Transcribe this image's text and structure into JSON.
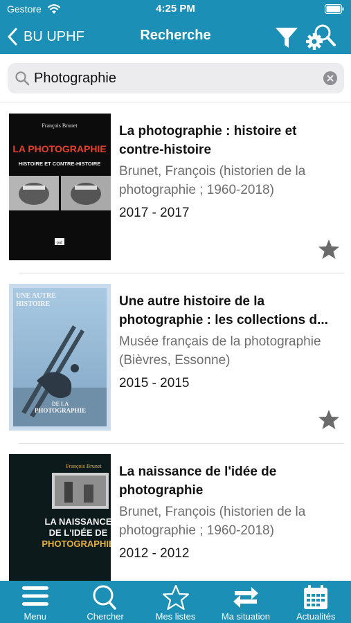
{
  "status": {
    "carrier": "Gestore",
    "time": "4:25 PM"
  },
  "nav": {
    "back_label": "BU UPHF",
    "title": "Recherche"
  },
  "search": {
    "value": "Photographie"
  },
  "results": [
    {
      "title_line1": "La photographie : histoire et",
      "title_line2": "contre-histoire",
      "author_line1": "Brunet, François (historien de la",
      "author_line2": "photographie ; 1960-2018)",
      "date": "2017 - 2017",
      "cover": {
        "author": "François Brunet",
        "title_line1": "LA PHOTOGRAPHIE",
        "title_line2": "HISTOIRE ET CONTRE-HISTOIRE",
        "publisher": "puf"
      }
    },
    {
      "title_line1": "Une autre histoire de la",
      "title_line2": "photographie : les collections d...",
      "author_line1": "Musée français de la photographie",
      "author_line2": "(Bièvres, Essonne)",
      "date": "2015 - 2015",
      "cover": {
        "top_line1": "UNE AUTRE",
        "top_line2": "HISTOIRE",
        "bottom_line1": "DE LA",
        "bottom_line2": "PHOTOGRAPHIE"
      }
    },
    {
      "title_line1": "La naissance de l'idée de",
      "title_line2": "photographie",
      "author_line1": "Brunet, François (historien de la",
      "author_line2": "photographie ; 1960-2018)",
      "date": "2012 - 2012",
      "cover": {
        "author": "François Brunet",
        "line1": "LA NAISSANCE",
        "line2": "DE L'IDÉE DE",
        "line3": "PHOTOGRAPHIE"
      }
    }
  ],
  "tabs": [
    {
      "label": "Menu",
      "icon": "menu-icon"
    },
    {
      "label": "Chercher",
      "icon": "search-icon"
    },
    {
      "label": "Mes listes",
      "icon": "star-outline-icon"
    },
    {
      "label": "Ma situation",
      "icon": "swap-arrows-icon"
    },
    {
      "label": "Actualités",
      "icon": "calendar-icon"
    }
  ],
  "colors": {
    "primary": "#1b8fb5",
    "star": "#6b6b6b",
    "secondary_text": "#6e6e6e"
  }
}
